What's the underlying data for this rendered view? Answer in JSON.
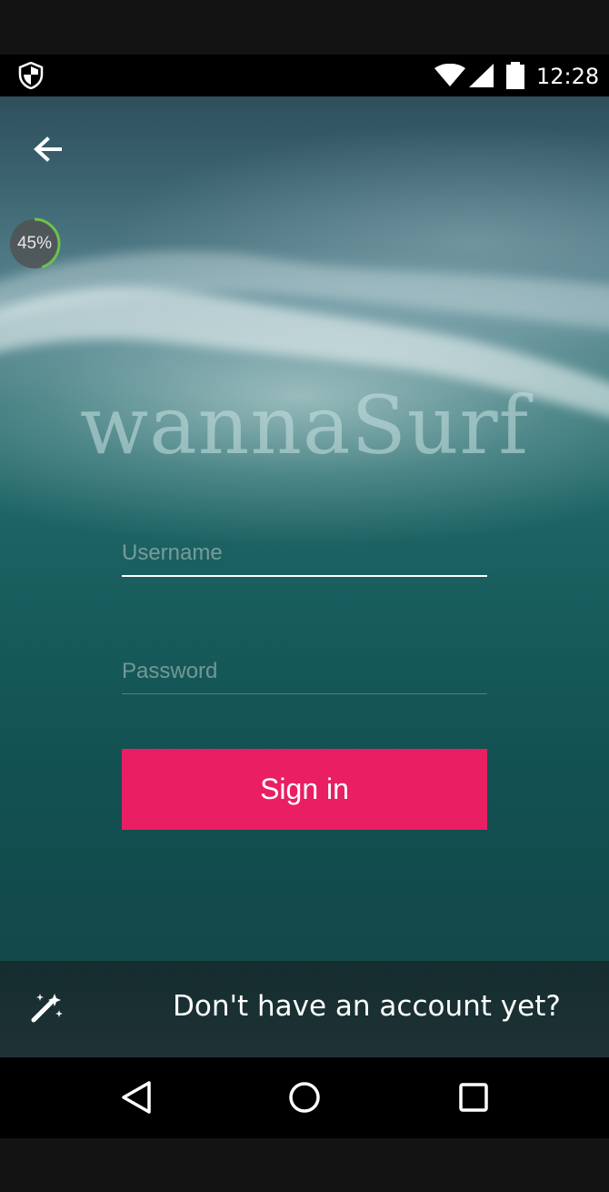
{
  "status_bar": {
    "time": "12:28",
    "icons": [
      "shield-icon",
      "wifi-icon",
      "signal-icon",
      "battery-icon"
    ]
  },
  "header": {
    "back_icon": "arrow-back-icon"
  },
  "progress_badge": {
    "label": "45%",
    "value": 0.45,
    "ring_color": "#6cc24a"
  },
  "logo": {
    "text": "wannaSurf"
  },
  "form": {
    "username_placeholder": "Username",
    "password_placeholder": "Password",
    "sign_in_label": "Sign in",
    "accent_color": "#e91e63"
  },
  "footer": {
    "magic_icon": "magic-wand-icon",
    "signup_label": "Don't have an account yet?"
  },
  "nav_bar": {
    "icons": [
      "back-triangle-icon",
      "home-circle-icon",
      "recents-square-icon"
    ]
  }
}
